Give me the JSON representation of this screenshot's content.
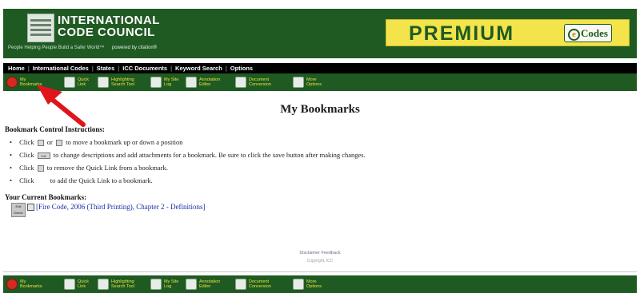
{
  "banner": {
    "logo_line1": "INTERNATIONAL",
    "logo_line2": "CODE COUNCIL",
    "tagline": "People Helping People Build a Safer World™",
    "powered_by": "powered by citation®",
    "premium": "PREMIUM",
    "ecodes": "Codes"
  },
  "nav": {
    "items": [
      "Home",
      "International Codes",
      "States",
      "ICC Documents",
      "Keyword Search",
      "Options"
    ]
  },
  "toolbar": {
    "items": [
      {
        "line1": "My",
        "line2": "Bookmarks"
      },
      {
        "line1": "Quick",
        "line2": "Link"
      },
      {
        "line1": "Highlighting",
        "line2": "Search Tool"
      },
      {
        "line1": "My Site",
        "line2": "Log"
      },
      {
        "line1": "Annotation",
        "line2": "Editor"
      },
      {
        "line1": "Document",
        "line2": "Conversion"
      },
      {
        "line1": "More",
        "line2": "Options"
      }
    ]
  },
  "page": {
    "title": "My Bookmarks",
    "instructions_heading": "Bookmark Control Instructions:",
    "instructions": {
      "i1_a": "Click",
      "i1_b": "or",
      "i1_c": "to move a bookmark up or down a position",
      "i2_a": "Click",
      "i2_b": "to change descriptions and add attachments for a bookmark. Be sure to click the save button after making changes.",
      "i3_a": "Click",
      "i3_b": "to remove the Quick Link from a bookmark.",
      "i4_a": "Click",
      "i4_b": "to add the Quick Link to a bookmark."
    },
    "edit_icon_label": "Edit",
    "current_heading": "Your Current Bookmarks:",
    "bookmark_button": {
      "line1": "Edit",
      "line2": "Delete"
    },
    "bookmark_link": "[Fire Code, 2006 (Third Printing), Chapter 2 - Definitions]"
  },
  "footer": {
    "links": "Disclaimer  Feedback",
    "copyright": "Copyright, ICC"
  },
  "colors": {
    "brand_green": "#1f5a23",
    "premium_yellow": "#f2e44a",
    "toolbar_text": "#e9e23c",
    "annotation_arrow": "#e0141b"
  }
}
